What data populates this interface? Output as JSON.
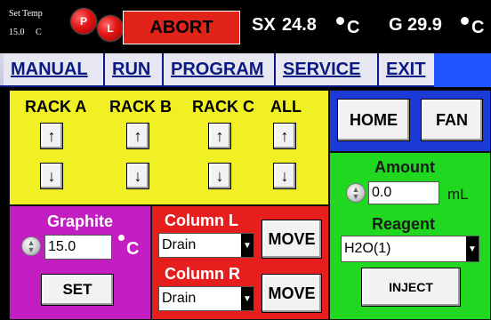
{
  "status": {
    "set_temp_label": "Set Temp",
    "set_temp_value": "15.0",
    "set_temp_unit": "C",
    "p_button": "P",
    "l_button": "L",
    "abort_label": "ABORT",
    "sx_label": "SX",
    "sx_value": "24.8",
    "g_label": "G",
    "g_value": "29.9",
    "temp_unit": "C"
  },
  "menu": {
    "items": [
      "MANUAL",
      "RUN",
      "PROGRAM",
      "SERVICE",
      "EXIT"
    ],
    "active": "MANUAL"
  },
  "racks": {
    "labels": [
      "RACK A",
      "RACK B",
      "RACK C",
      "ALL"
    ],
    "up_glyph": "↑",
    "down_glyph": "↓"
  },
  "home_panel": {
    "home_label": "HOME",
    "fan_label": "FAN"
  },
  "reagent_panel": {
    "amount_label": "Amount",
    "amount_value": "0.0",
    "amount_unit": "mL",
    "reagent_label": "Reagent",
    "reagent_value": "H2O(1)",
    "inject_label": "INJECT"
  },
  "graphite_panel": {
    "title": "Graphite",
    "value": "15.0",
    "unit": "C",
    "set_label": "SET"
  },
  "column_panel": {
    "column_l_label": "Column L",
    "column_l_value": "Drain",
    "column_r_label": "Column R",
    "column_r_value": "Drain",
    "move_label": "MOVE"
  },
  "colors": {
    "rack_panel": "#f0f024",
    "home_panel": "#1c3bd6",
    "reagent_panel": "#20d820",
    "graphite_panel": "#c21ec2",
    "column_panel": "#e61e1e",
    "abort": "#e2231a",
    "menu_text": "#0b1a82"
  }
}
